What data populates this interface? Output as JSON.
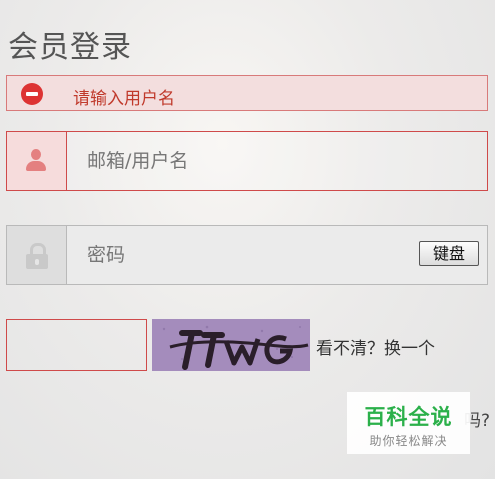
{
  "page": {
    "title": "会员登录"
  },
  "error": {
    "message": "请输入用户名"
  },
  "username": {
    "placeholder": "邮箱/用户名"
  },
  "password": {
    "placeholder": "密码",
    "keyboard_label": "键盘"
  },
  "captcha": {
    "image_text": "TTWG",
    "refresh_label": "看不清？换一个"
  },
  "forgot": {
    "partial_text": "吗?"
  },
  "watermark": {
    "main": "百科全说",
    "sub": "助你轻松解决"
  },
  "colors": {
    "error": "#c0392b",
    "error_bg": "#f3dede",
    "field_border_error": "#cf4a4a",
    "badge_green": "#2bb04a"
  }
}
